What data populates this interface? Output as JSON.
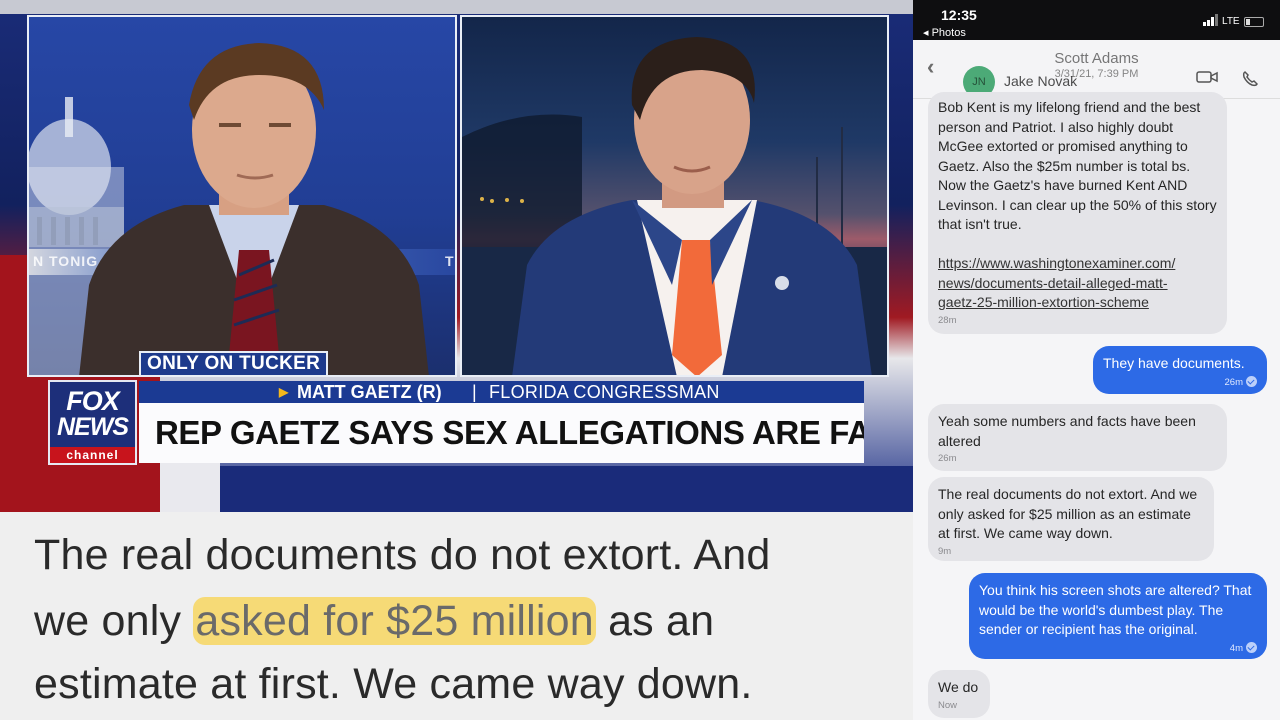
{
  "broadcast": {
    "studio_ticker_left": "N TONIG",
    "studio_ticker_right": "T",
    "badge": "ONLY ON TUCKER",
    "logo": {
      "line1": "FOX",
      "line2": "NEWS",
      "line3": "channel"
    },
    "guest_name": "MATT GAETZ (R)",
    "separator": "|",
    "guest_title": "FLORIDA CONGRESSMAN",
    "headline": "REP GAETZ SAYS SEX ALLEGATIONS ARE FALSE",
    "colors": {
      "fox_blue": "#1b3a93",
      "fox_red": "#c8141c",
      "tie_orange": "#f26a3a"
    }
  },
  "quote": {
    "line1": "The real documents do not extort. And",
    "line2_before": "we only ",
    "line2_highlight": "asked for $25 million",
    "line2_after": " as an",
    "line3": "estimate at first. We came way down.",
    "highlight_color": "#f7d660"
  },
  "phone": {
    "status": {
      "time": "12:35",
      "back": "◂ Photos",
      "network": "LTE"
    },
    "header": {
      "title": "Scott Adams",
      "date": "3/31/21, 7:39 PM",
      "avatar": "JN",
      "contact": "Jake Novak",
      "back_icon": "chevron-left",
      "video_icon": "video-camera",
      "call_icon": "phone"
    },
    "messages": [
      {
        "dir": "in",
        "text": "Bob Kent is my lifelong friend and the best person and Patriot. I also highly doubt McGee extorted or promised anything to Gaetz. Also the $25m number is total bs. Now the Gaetz's have burned Kent AND Levinson. I can clear up the 50% of this story that isn't true.",
        "link": "https://www.washingtonexaminer.com/news/documents-detail-alleged-matt-gaetz-25-million-extortion-scheme",
        "link_lines": [
          "https://www.washingtonexaminer.com/",
          "news/documents-detail-alleged-matt-",
          "gaetz-25-million-extortion-scheme"
        ],
        "time": "28m"
      },
      {
        "dir": "out",
        "text": "They have documents.",
        "time": "26m"
      },
      {
        "dir": "in",
        "text": "Yeah some numbers and facts have been altered",
        "time": "26m"
      },
      {
        "dir": "in",
        "text": "The real documents do not extort. And we only asked for $25 million as an estimate at first. We came way down.",
        "time": "9m"
      },
      {
        "dir": "out",
        "text": "You think his screen shots are altered? That would be the world's dumbest play. The sender or recipient has the original.",
        "time": "4m"
      },
      {
        "dir": "in",
        "text": "We do",
        "time": "Now"
      }
    ]
  }
}
